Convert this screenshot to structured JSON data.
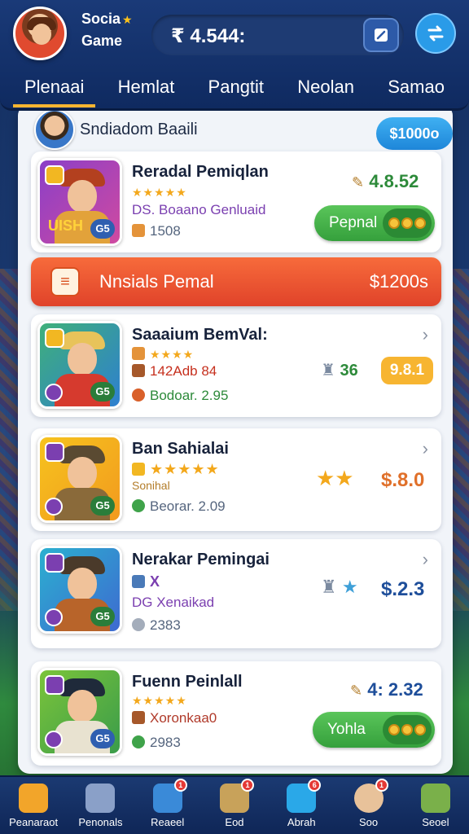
{
  "header": {
    "app_title_line1": "Socia",
    "app_title_line2": "Game",
    "balance": "₹ 4.544:",
    "tabs": [
      {
        "label": "Plenaai",
        "active": true
      },
      {
        "label": "Hemlat",
        "active": false
      },
      {
        "label": "Pangtit",
        "active": false
      },
      {
        "label": "Neolan",
        "active": false
      },
      {
        "label": "Samao",
        "active": false
      }
    ]
  },
  "profile": {
    "name": "Sndiadom Baaili",
    "badge": "$1000o"
  },
  "items": [
    {
      "title": "Reradal Pemiqlan",
      "stars": "★★★★★",
      "line2": "DS. Boaano Genluaid",
      "line3": "1508",
      "price": "4.8.52",
      "button": "Pepnal",
      "thumb_text": "UISH"
    },
    {
      "title": "Saaaium BemVal:",
      "stars": "★★★★",
      "line2": "142Adb 84",
      "line3": "Bodoar. 2.95",
      "rating": "36",
      "price": "9.8.1"
    },
    {
      "title": "Ban Sahialai",
      "stars": "★★★★★",
      "line2": "Sonihal",
      "line3": "Beorar. 2.09",
      "price": "$.8.0"
    },
    {
      "title": "Nerakar Pemingai",
      "line1": "X",
      "line2": "DG Xenaikad",
      "line3": "2383",
      "price": "$.2.3"
    },
    {
      "title": "Fuenn Peinlall",
      "stars": "★★★★★",
      "line2": "Xoronkaa0",
      "line3": "2983",
      "price": "4: 2.32",
      "button": "Yohla"
    }
  ],
  "banner": {
    "label": "Nnsials Pemal",
    "price": "$1200s"
  },
  "bottom_nav": [
    {
      "label": "Peanaraot",
      "icon": "house-icon",
      "badge": ""
    },
    {
      "label": "Penonals",
      "icon": "pencil-icon",
      "badge": ""
    },
    {
      "label": "Reaeel",
      "icon": "tools-icon",
      "badge": "1"
    },
    {
      "label": "Eod",
      "icon": "chart-icon",
      "badge": "1"
    },
    {
      "label": "Abrah",
      "icon": "bag-icon",
      "badge": "6"
    },
    {
      "label": "Soo",
      "icon": "player-icon",
      "badge": "1"
    },
    {
      "label": "Seoel",
      "icon": "cards-icon",
      "badge": ""
    }
  ]
}
